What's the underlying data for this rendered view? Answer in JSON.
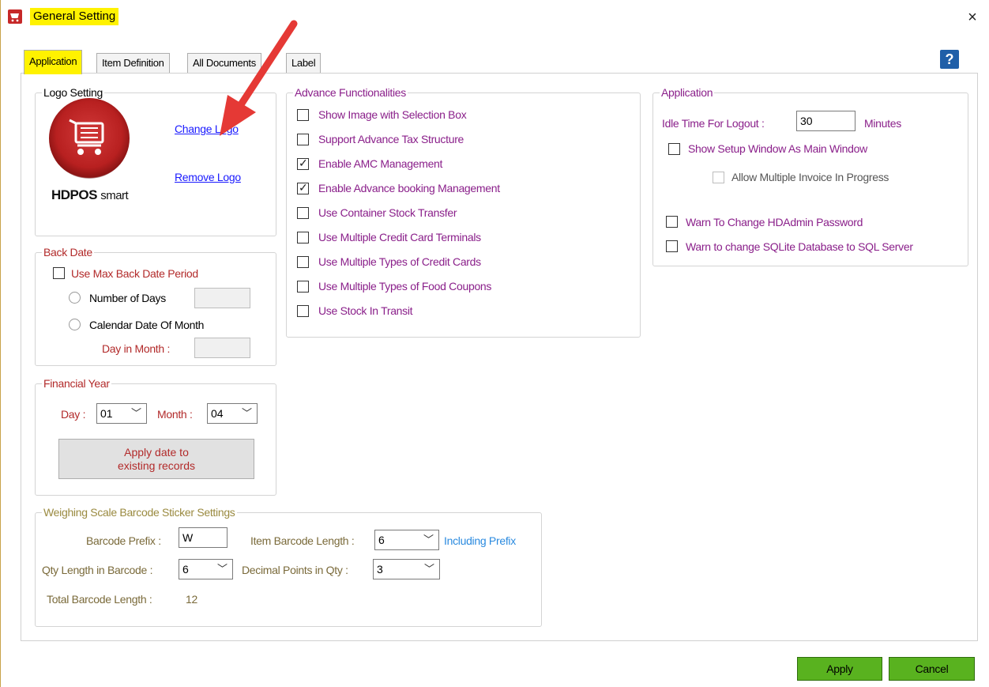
{
  "window": {
    "title": "General Setting",
    "close_icon": "×",
    "help_label": "?"
  },
  "tabs": [
    {
      "label": "Application",
      "active": true
    },
    {
      "label": "Item Definition"
    },
    {
      "label": "All Documents"
    },
    {
      "label": "Label"
    }
  ],
  "logo_setting": {
    "legend": "Logo Setting",
    "logo_brand": "HDPOS",
    "logo_suffix": "smart",
    "change_logo": "Change Logo",
    "remove_logo": "Remove Logo"
  },
  "back_date": {
    "legend": "Back Date",
    "use_max": "Use Max Back Date Period",
    "number_of_days": "Number of Days",
    "calendar_date": "Calendar Date Of Month",
    "day_in_month": "Day in Month :"
  },
  "financial_year": {
    "legend": "Financial Year",
    "day_label": "Day :",
    "day_value": "01",
    "month_label": "Month :",
    "month_value": "04",
    "apply_line1": "Apply date to",
    "apply_line2": "existing records"
  },
  "weighing": {
    "legend": "Weighing Scale Barcode Sticker Settings",
    "barcode_prefix_label": "Barcode Prefix :",
    "barcode_prefix_value": "W",
    "item_length_label": "Item Barcode Length :",
    "item_length_value": "6",
    "including_prefix": "Including Prefix",
    "qty_length_label": "Qty Length in Barcode :",
    "qty_length_value": "6",
    "decimal_label": "Decimal Points in Qty :",
    "decimal_value": "3",
    "total_label": "Total Barcode Length :",
    "total_value": "12"
  },
  "advance": {
    "legend": "Advance Functionalities",
    "items": [
      {
        "label": "Show Image with Selection Box",
        "checked": false
      },
      {
        "label": "Support Advance Tax Structure",
        "checked": false
      },
      {
        "label": "Enable AMC Management",
        "checked": true
      },
      {
        "label": "Enable Advance booking Management",
        "checked": true
      },
      {
        "label": "Use Container Stock Transfer",
        "checked": false
      },
      {
        "label": "Use Multiple Credit Card Terminals",
        "checked": false
      },
      {
        "label": "Use Multiple Types of Credit Cards",
        "checked": false
      },
      {
        "label": "Use Multiple Types of Food Coupons",
        "checked": false
      },
      {
        "label": "Use Stock In Transit",
        "checked": false
      }
    ]
  },
  "application_group": {
    "legend": "Application",
    "idle_label": "Idle Time For Logout :",
    "idle_value": "30",
    "minutes": "Minutes",
    "show_setup": "Show Setup Window As Main Window",
    "allow_multiple": "Allow Multiple Invoice In Progress",
    "warn_password": "Warn To Change HDAdmin Password",
    "warn_sqlite": "Warn to change SQLite Database to SQL Server"
  },
  "footer": {
    "apply": "Apply",
    "cancel": "Cancel"
  },
  "colors": {
    "highlight": "#fff200",
    "green_button": "#59b21f",
    "annotation_arrow": "#e53935"
  }
}
